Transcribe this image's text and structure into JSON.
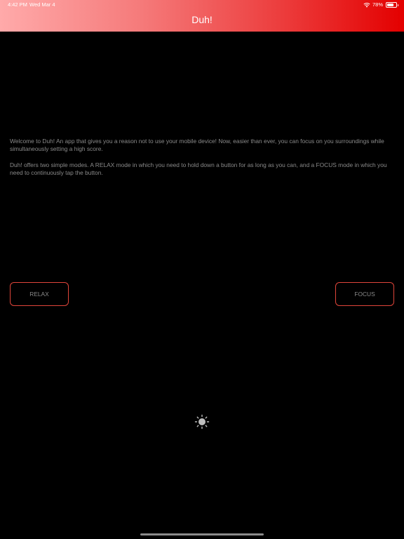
{
  "status_bar": {
    "time": "4:42 PM",
    "date": "Wed Mar 4",
    "battery": "78%",
    "battery_level": 0.78
  },
  "header": {
    "title": "Duh!"
  },
  "intro": {
    "paragraph_1": "Welcome to Duh! An app that gives you a reason not to use your mobile device! Now, easier than ever, you can focus on you surroundings while simultaneously setting a high score.",
    "paragraph_2": "Duh! offers two simple modes. A RELAX mode in which you need to hold down a button for as long as you can, and a FOCUS mode in which you need to continuously tap the button."
  },
  "buttons": {
    "relax_label": "RELAX",
    "focus_label": "FOCUS"
  },
  "icons": {
    "spinner": "activity-spinner-icon",
    "wifi": "wifi-icon",
    "battery": "battery-icon"
  },
  "colors": {
    "header_gradient_start": "#ffaaaa",
    "header_gradient_end": "#e30000",
    "button_border": "#e0453a",
    "body_text": "#8a8a8a",
    "background": "#000000"
  }
}
